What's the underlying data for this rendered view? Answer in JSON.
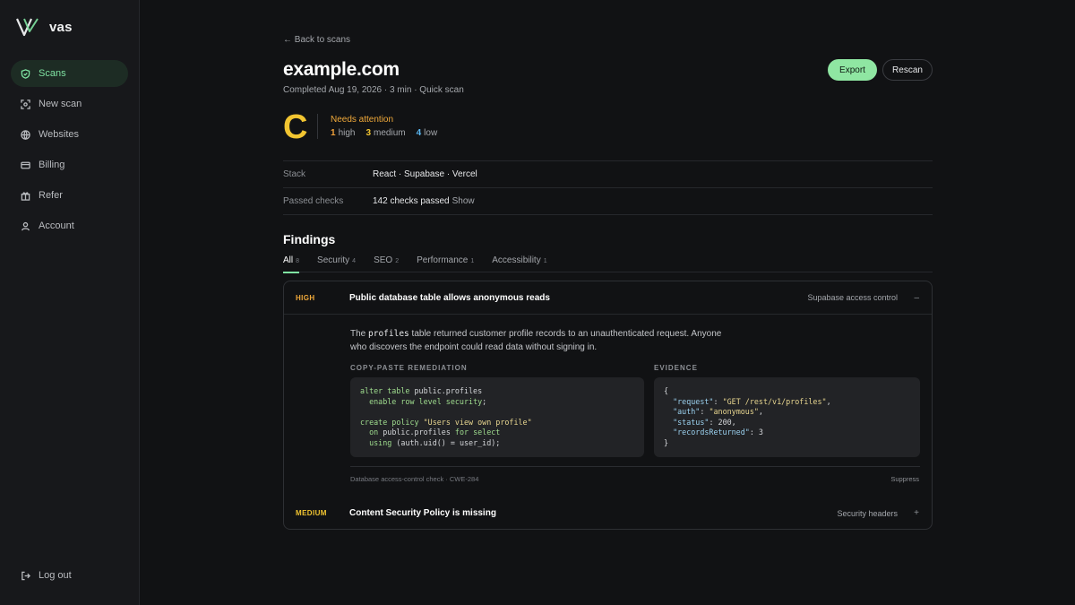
{
  "app": {
    "name": "vas"
  },
  "sidebar": {
    "items": [
      {
        "label": "Scans",
        "active": true
      },
      {
        "label": "New scan"
      },
      {
        "label": "Websites"
      },
      {
        "label": "Billing"
      },
      {
        "label": "Refer"
      },
      {
        "label": "Account"
      }
    ],
    "logout_label": "Log out"
  },
  "header": {
    "back_label": "← Back to scans",
    "title": "example.com",
    "subtitle": "Completed Aug 19, 2026 · 3 min · Quick scan",
    "export_label": "Export",
    "rescan_label": "Rescan"
  },
  "grade": {
    "letter": "C",
    "status": "Needs attention",
    "high_count": "1",
    "high_label": "high",
    "medium_count": "3",
    "medium_label": "medium",
    "low_count": "4",
    "low_label": "low"
  },
  "info": {
    "stack_key": "Stack",
    "stack_val": "React · Supabase · Vercel",
    "passed_key": "Passed checks",
    "passed_val": "142 checks passed",
    "passed_show": "Show"
  },
  "findings": {
    "title": "Findings",
    "tabs": [
      {
        "label": "All",
        "count": "8"
      },
      {
        "label": "Security",
        "count": "4"
      },
      {
        "label": "SEO",
        "count": "2"
      },
      {
        "label": "Performance",
        "count": "1"
      },
      {
        "label": "Accessibility",
        "count": "1"
      }
    ],
    "items": [
      {
        "severity": "HIGH",
        "title": "Public database table allows anonymous reads",
        "category": "Supabase access control",
        "toggle": "–",
        "desc_pre": "The ",
        "desc_code": "profiles",
        "desc_post": " table returned customer profile records to an unauthenticated request. Anyone who discovers the endpoint could read data without signing in.",
        "remediation_label": "COPY-PASTE REMEDIATION",
        "evidence_label": "EVIDENCE",
        "remediation_code": [
          {
            "kw": "alter table",
            "rest": " public.profiles"
          },
          {
            "indent": "  ",
            "kw": "enable row level security",
            "rest": ";"
          },
          {
            "blank": true
          },
          {
            "kw": "create policy",
            "str": " \"Users view own profile\""
          },
          {
            "indent": "  ",
            "kw": "on",
            "rest": " public.profiles ",
            "kw2": "for select"
          },
          {
            "indent": "  ",
            "kw": "using",
            "rest": " (auth.uid() = user_id);"
          }
        ],
        "evidence": {
          "open": "{",
          "lines": [
            {
              "key": "\"request\"",
              "val": "\"GET /rest/v1/profiles\"",
              "type": "str",
              "comma": ","
            },
            {
              "key": "\"auth\"",
              "val": "\"anonymous\"",
              "type": "str",
              "comma": ","
            },
            {
              "key": "\"status\"",
              "val": "200",
              "type": "num",
              "comma": ","
            },
            {
              "key": "\"recordsReturned\"",
              "val": "3",
              "type": "num",
              "comma": ""
            }
          ],
          "close": "}"
        },
        "footer": "Database access-control check · CWE-284",
        "suppress": "Suppress"
      },
      {
        "severity": "MEDIUM",
        "title": "Content Security Policy is missing",
        "category": "Security headers",
        "toggle": "+"
      }
    ]
  },
  "colors": {
    "accent": "#7fe3a2",
    "grade": "#f2c531",
    "high": "#f2a13a",
    "low": "#5ab7f2"
  }
}
